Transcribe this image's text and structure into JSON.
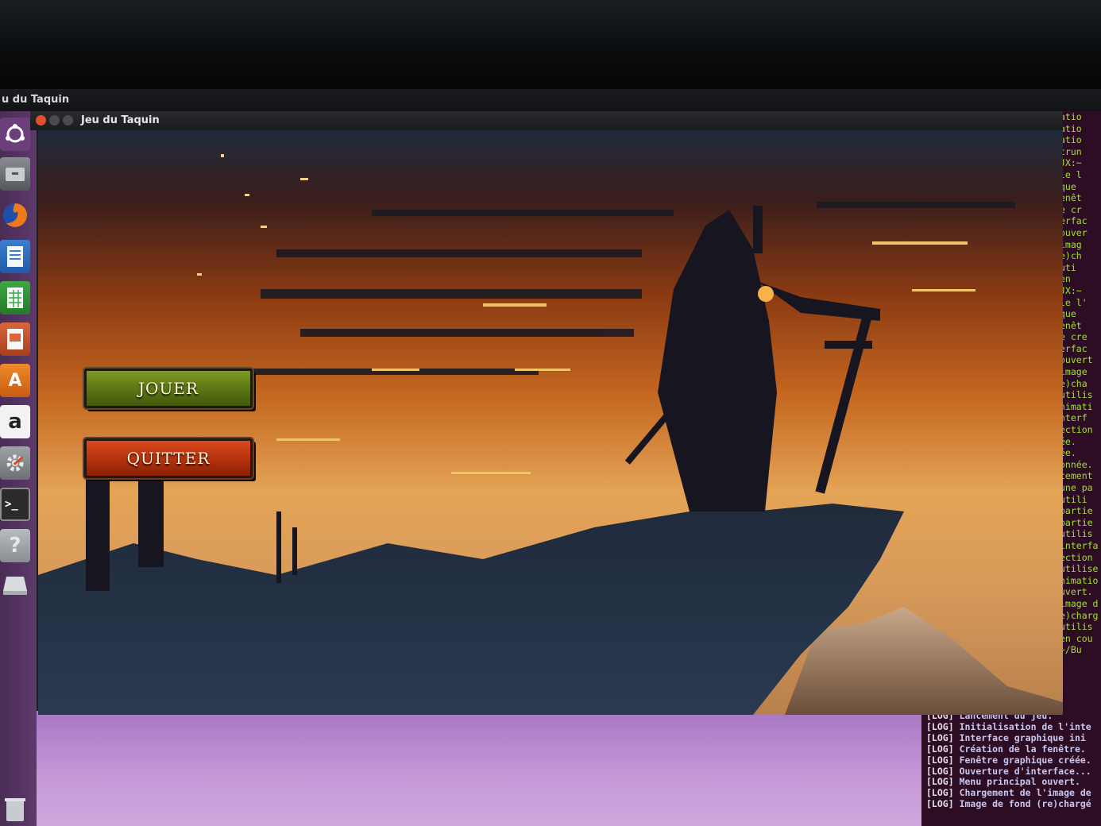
{
  "panel": {
    "title": "u du Taquin"
  },
  "window": {
    "title": "Jeu du Taquin"
  },
  "menu": {
    "play_label": "JOUER",
    "quit_label": "QUITTER"
  },
  "launcher": {
    "items": [
      {
        "icon": "ubuntu-dash-icon"
      },
      {
        "icon": "files-icon"
      },
      {
        "icon": "firefox-icon"
      },
      {
        "icon": "libreoffice-writer-icon"
      },
      {
        "icon": "libreoffice-calc-icon"
      },
      {
        "icon": "libreoffice-impress-icon"
      },
      {
        "icon": "software-center-icon",
        "glyph": "A"
      },
      {
        "icon": "amazon-icon",
        "glyph": "a"
      },
      {
        "icon": "system-settings-icon"
      },
      {
        "icon": "terminal-icon",
        "glyph": ">_"
      },
      {
        "icon": "help-icon",
        "glyph": "?"
      },
      {
        "icon": "drive-icon"
      },
      {
        "icon": "trash-icon"
      }
    ]
  },
  "terminal_right": {
    "lines": [
      "atio",
      "",
      "atio",
      "atio",
      "trun",
      "JX:~",
      "",
      "le l",
      "que",
      "enêt",
      "e cr",
      "erfac",
      "ouver",
      "imag",
      "e)ch",
      " uti",
      " en",
      "JX:~",
      "",
      "le l'",
      "que",
      "enêt",
      "e cre",
      "erfac",
      "ouvert",
      "image",
      "e)cha",
      "utilis",
      "nimati",
      "nterf",
      "ection",
      "ée.",
      "ée.",
      "onnée.",
      "cement",
      "une pa",
      " utili",
      "partie",
      "partie",
      "utilis",
      "interfa",
      "ection",
      "utilise",
      "nimatio",
      "uvert.",
      "image d",
      "e)charg",
      "utilis",
      " en cou",
      "~/Bu"
    ]
  },
  "terminal_bottom": {
    "lines": [
      {
        "tag": "[LOG]",
        "msg": "Lancement du jeu."
      },
      {
        "tag": "[LOG]",
        "msg": "Initialisation de l'inte"
      },
      {
        "tag": "[LOG]",
        "msg": "Interface graphique ini"
      },
      {
        "tag": "[LOG]",
        "msg": "Création de la fenêtre."
      },
      {
        "tag": "[LOG]",
        "msg": "Fenêtre graphique créée."
      },
      {
        "tag": "[LOG]",
        "msg": "Ouverture d'interface..."
      },
      {
        "tag": "[LOG]",
        "msg": "Menu principal ouvert."
      },
      {
        "tag": "[LOG]",
        "msg": "Chargement de l'image de"
      },
      {
        "tag": "[LOG]",
        "msg": "Image de fond (re)chargé"
      }
    ]
  }
}
